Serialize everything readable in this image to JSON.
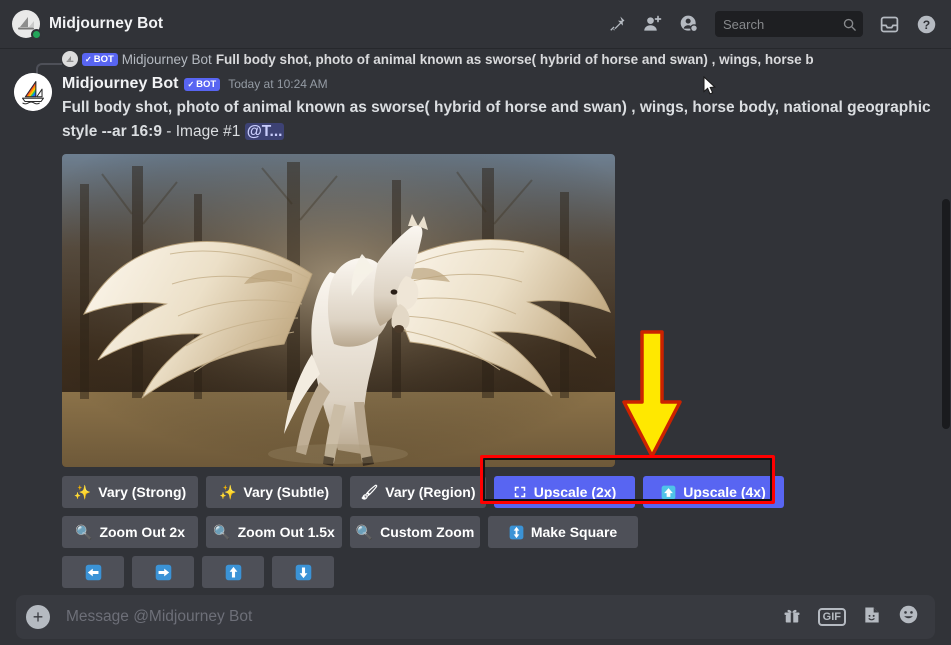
{
  "header": {
    "title": "Midjourney Bot",
    "icons": [
      "pin-icon",
      "add-friend-icon",
      "user-profile-icon",
      "inbox-icon",
      "help-icon"
    ],
    "search": {
      "placeholder": "Search",
      "value": "Search"
    }
  },
  "reply": {
    "bot_tag": "BOT",
    "check": "✓",
    "author": "Midjourney Bot",
    "text": "Full body shot, photo of animal known as sworse( hybrid of horse and swan) , wings, horse b"
  },
  "message": {
    "author": "Midjourney Bot",
    "bot_tag": "BOT",
    "check": "✓",
    "timestamp": "Today at 10:24 AM",
    "prompt": "Full body shot, photo of animal known as sworse( hybrid of horse and swan) , wings, horse body, national geographic style --ar 16:9",
    "separator": " - ",
    "image_label": "Image #1",
    "mention": "@T..."
  },
  "buttons": {
    "row1": [
      {
        "label": "Vary (Strong)",
        "icon": "magic-wand-icon",
        "glyph": "✨",
        "style": "secondary"
      },
      {
        "label": "Vary (Subtle)",
        "icon": "magic-wand-icon",
        "glyph": "✨",
        "style": "secondary"
      },
      {
        "label": "Vary (Region)",
        "icon": "paintbrush-icon",
        "glyph": "🖌",
        "style": "secondary"
      },
      {
        "label": "Upscale (2x)",
        "icon": "expand-icon",
        "glyph": "⛶",
        "style": "primary"
      },
      {
        "label": "Upscale (4x)",
        "icon": "up-arrow-icon",
        "glyph": "🔼",
        "style": "primary"
      }
    ],
    "row2": [
      {
        "label": "Zoom Out 2x",
        "icon": "magnifier-icon",
        "glyph": "🔍",
        "style": "secondary"
      },
      {
        "label": "Zoom Out 1.5x",
        "icon": "magnifier-icon",
        "glyph": "🔍",
        "style": "secondary"
      },
      {
        "label": "Custom Zoom",
        "icon": "magnifier-icon",
        "glyph": "🔍",
        "style": "secondary"
      },
      {
        "label": "Make Square",
        "icon": "up-down-arrow-icon",
        "glyph": "↕",
        "style": "secondary"
      }
    ],
    "row3": [
      {
        "label": "",
        "icon": "pan-left-icon",
        "glyph": "⬅",
        "style": "secondary"
      },
      {
        "label": "",
        "icon": "pan-right-icon",
        "glyph": "➡",
        "style": "secondary"
      },
      {
        "label": "",
        "icon": "pan-up-icon",
        "glyph": "⬆",
        "style": "secondary"
      },
      {
        "label": "",
        "icon": "pan-down-icon",
        "glyph": "⬇",
        "style": "secondary"
      }
    ]
  },
  "annotation": {
    "arrow_fill": "#ffe800",
    "arrow_stroke": "#cc2200",
    "highlight_color": "#ff0000"
  },
  "composer": {
    "placeholder": "Message @Midjourney Bot",
    "plus": "+",
    "gif_label": "GIF",
    "icons": [
      "gift-icon",
      "gif-icon",
      "sticker-icon",
      "emoji-icon"
    ]
  }
}
